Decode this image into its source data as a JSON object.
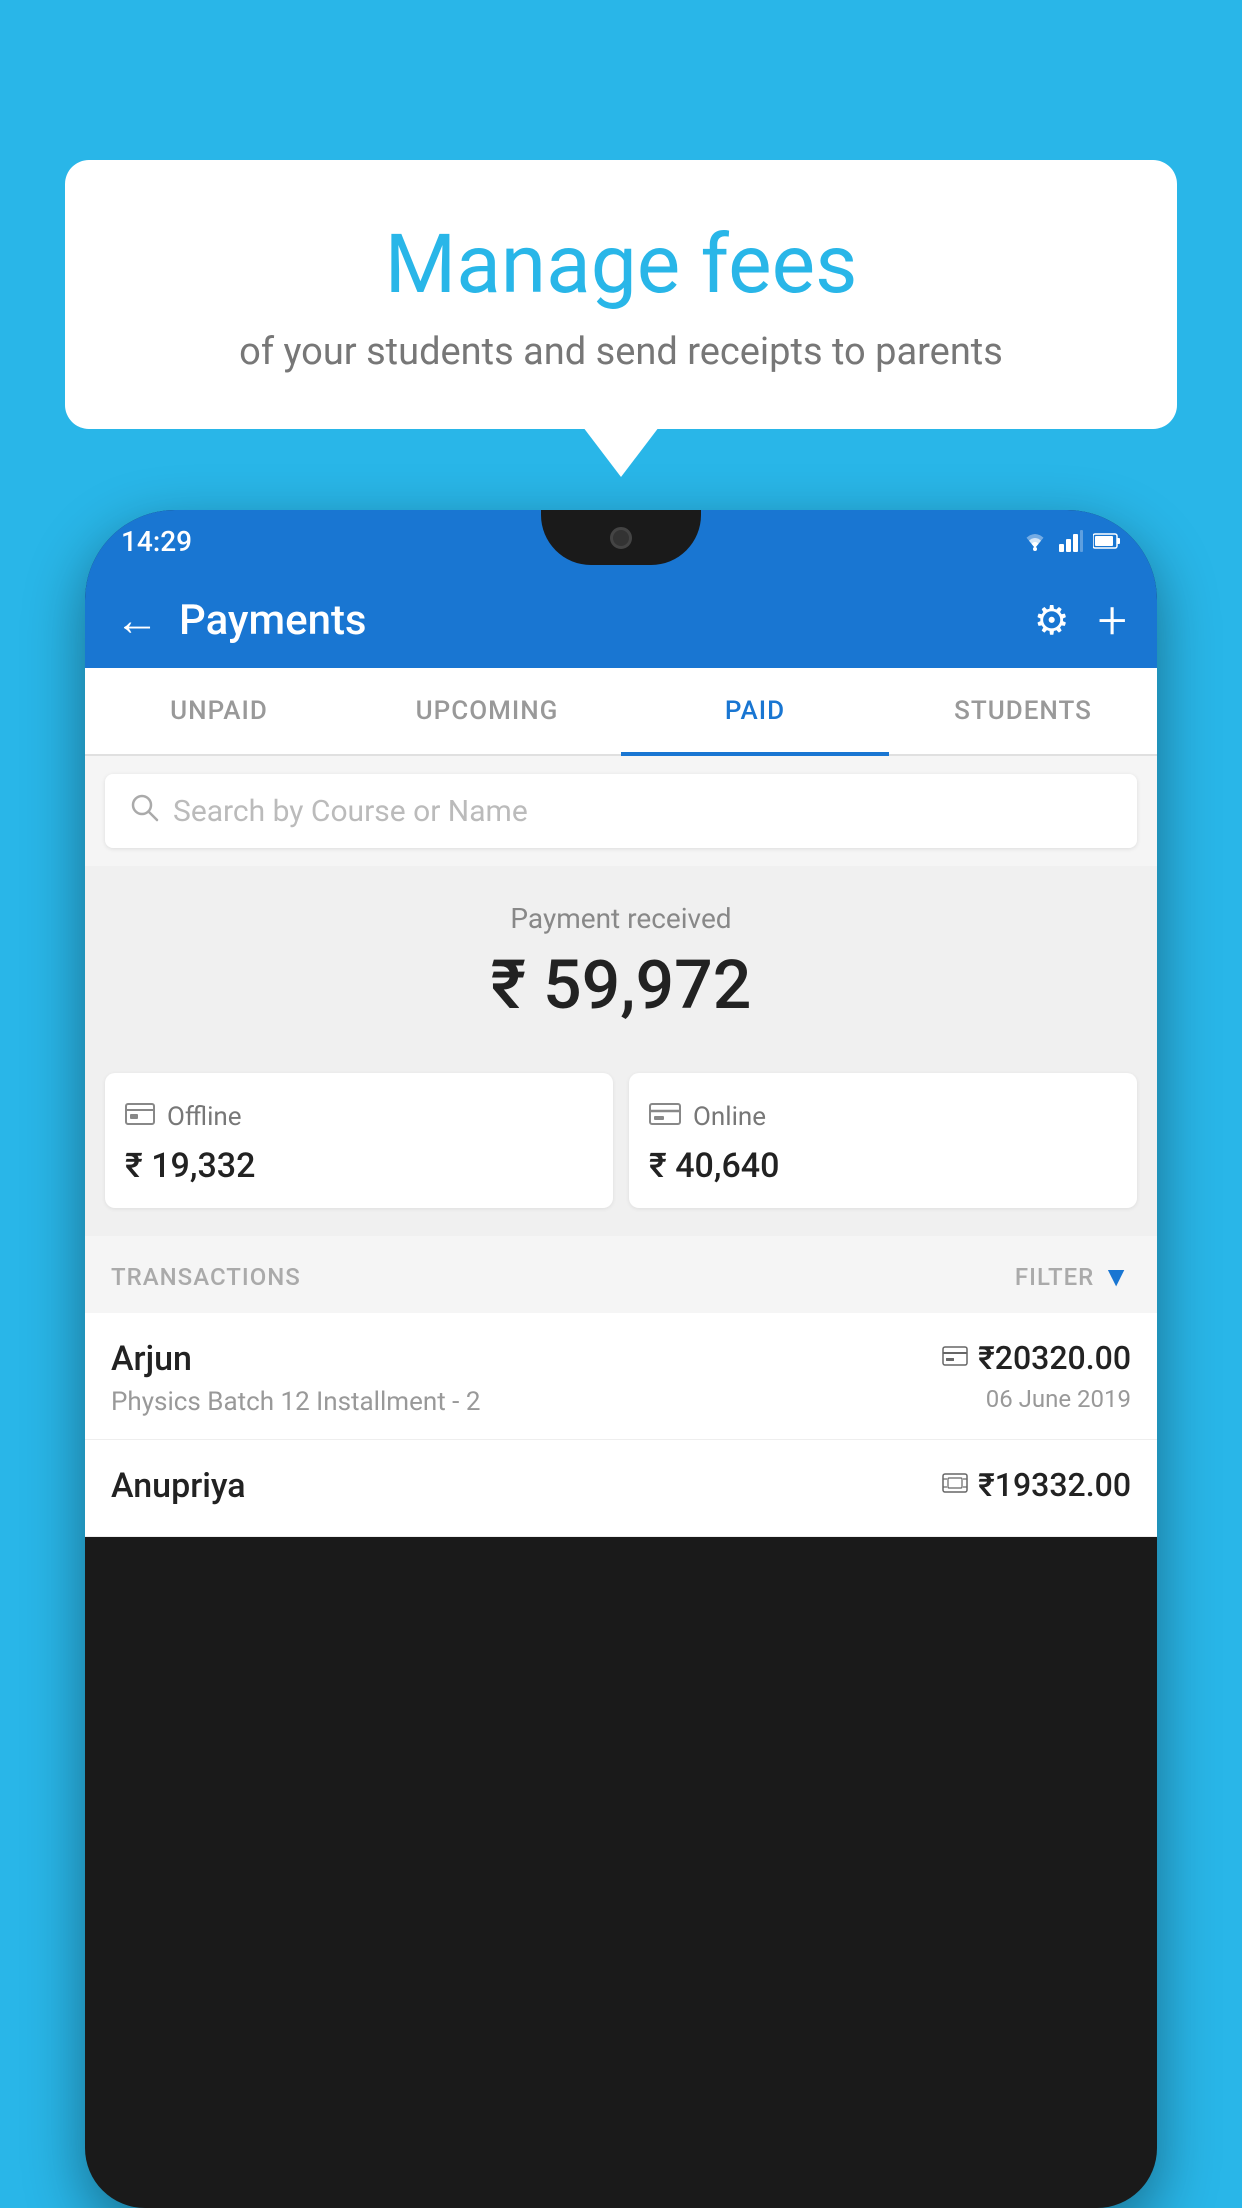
{
  "background_color": "#29b6e8",
  "bubble": {
    "title": "Manage fees",
    "subtitle": "of your students and send receipts to parents"
  },
  "phone": {
    "status_bar": {
      "time": "14:29",
      "icons": [
        "wifi",
        "signal",
        "battery"
      ]
    },
    "app_bar": {
      "title": "Payments",
      "back_label": "←",
      "settings_icon": "gear-icon",
      "add_icon": "plus-icon"
    },
    "tabs": [
      {
        "label": "UNPAID",
        "active": false
      },
      {
        "label": "UPCOMING",
        "active": false
      },
      {
        "label": "PAID",
        "active": true
      },
      {
        "label": "STUDENTS",
        "active": false
      }
    ],
    "search": {
      "placeholder": "Search by Course or Name"
    },
    "payment_summary": {
      "label": "Payment received",
      "amount": "₹ 59,972",
      "offline": {
        "label": "Offline",
        "amount": "₹ 19,332"
      },
      "online": {
        "label": "Online",
        "amount": "₹ 40,640"
      }
    },
    "transactions_section": {
      "header": "TRANSACTIONS",
      "filter_label": "FILTER"
    },
    "transactions": [
      {
        "name": "Arjun",
        "description": "Physics Batch 12 Installment - 2",
        "amount": "₹20320.00",
        "date": "06 June 2019",
        "method": "card"
      },
      {
        "name": "Anupriya",
        "description": "",
        "amount": "₹19332.00",
        "date": "",
        "method": "cash"
      }
    ]
  }
}
